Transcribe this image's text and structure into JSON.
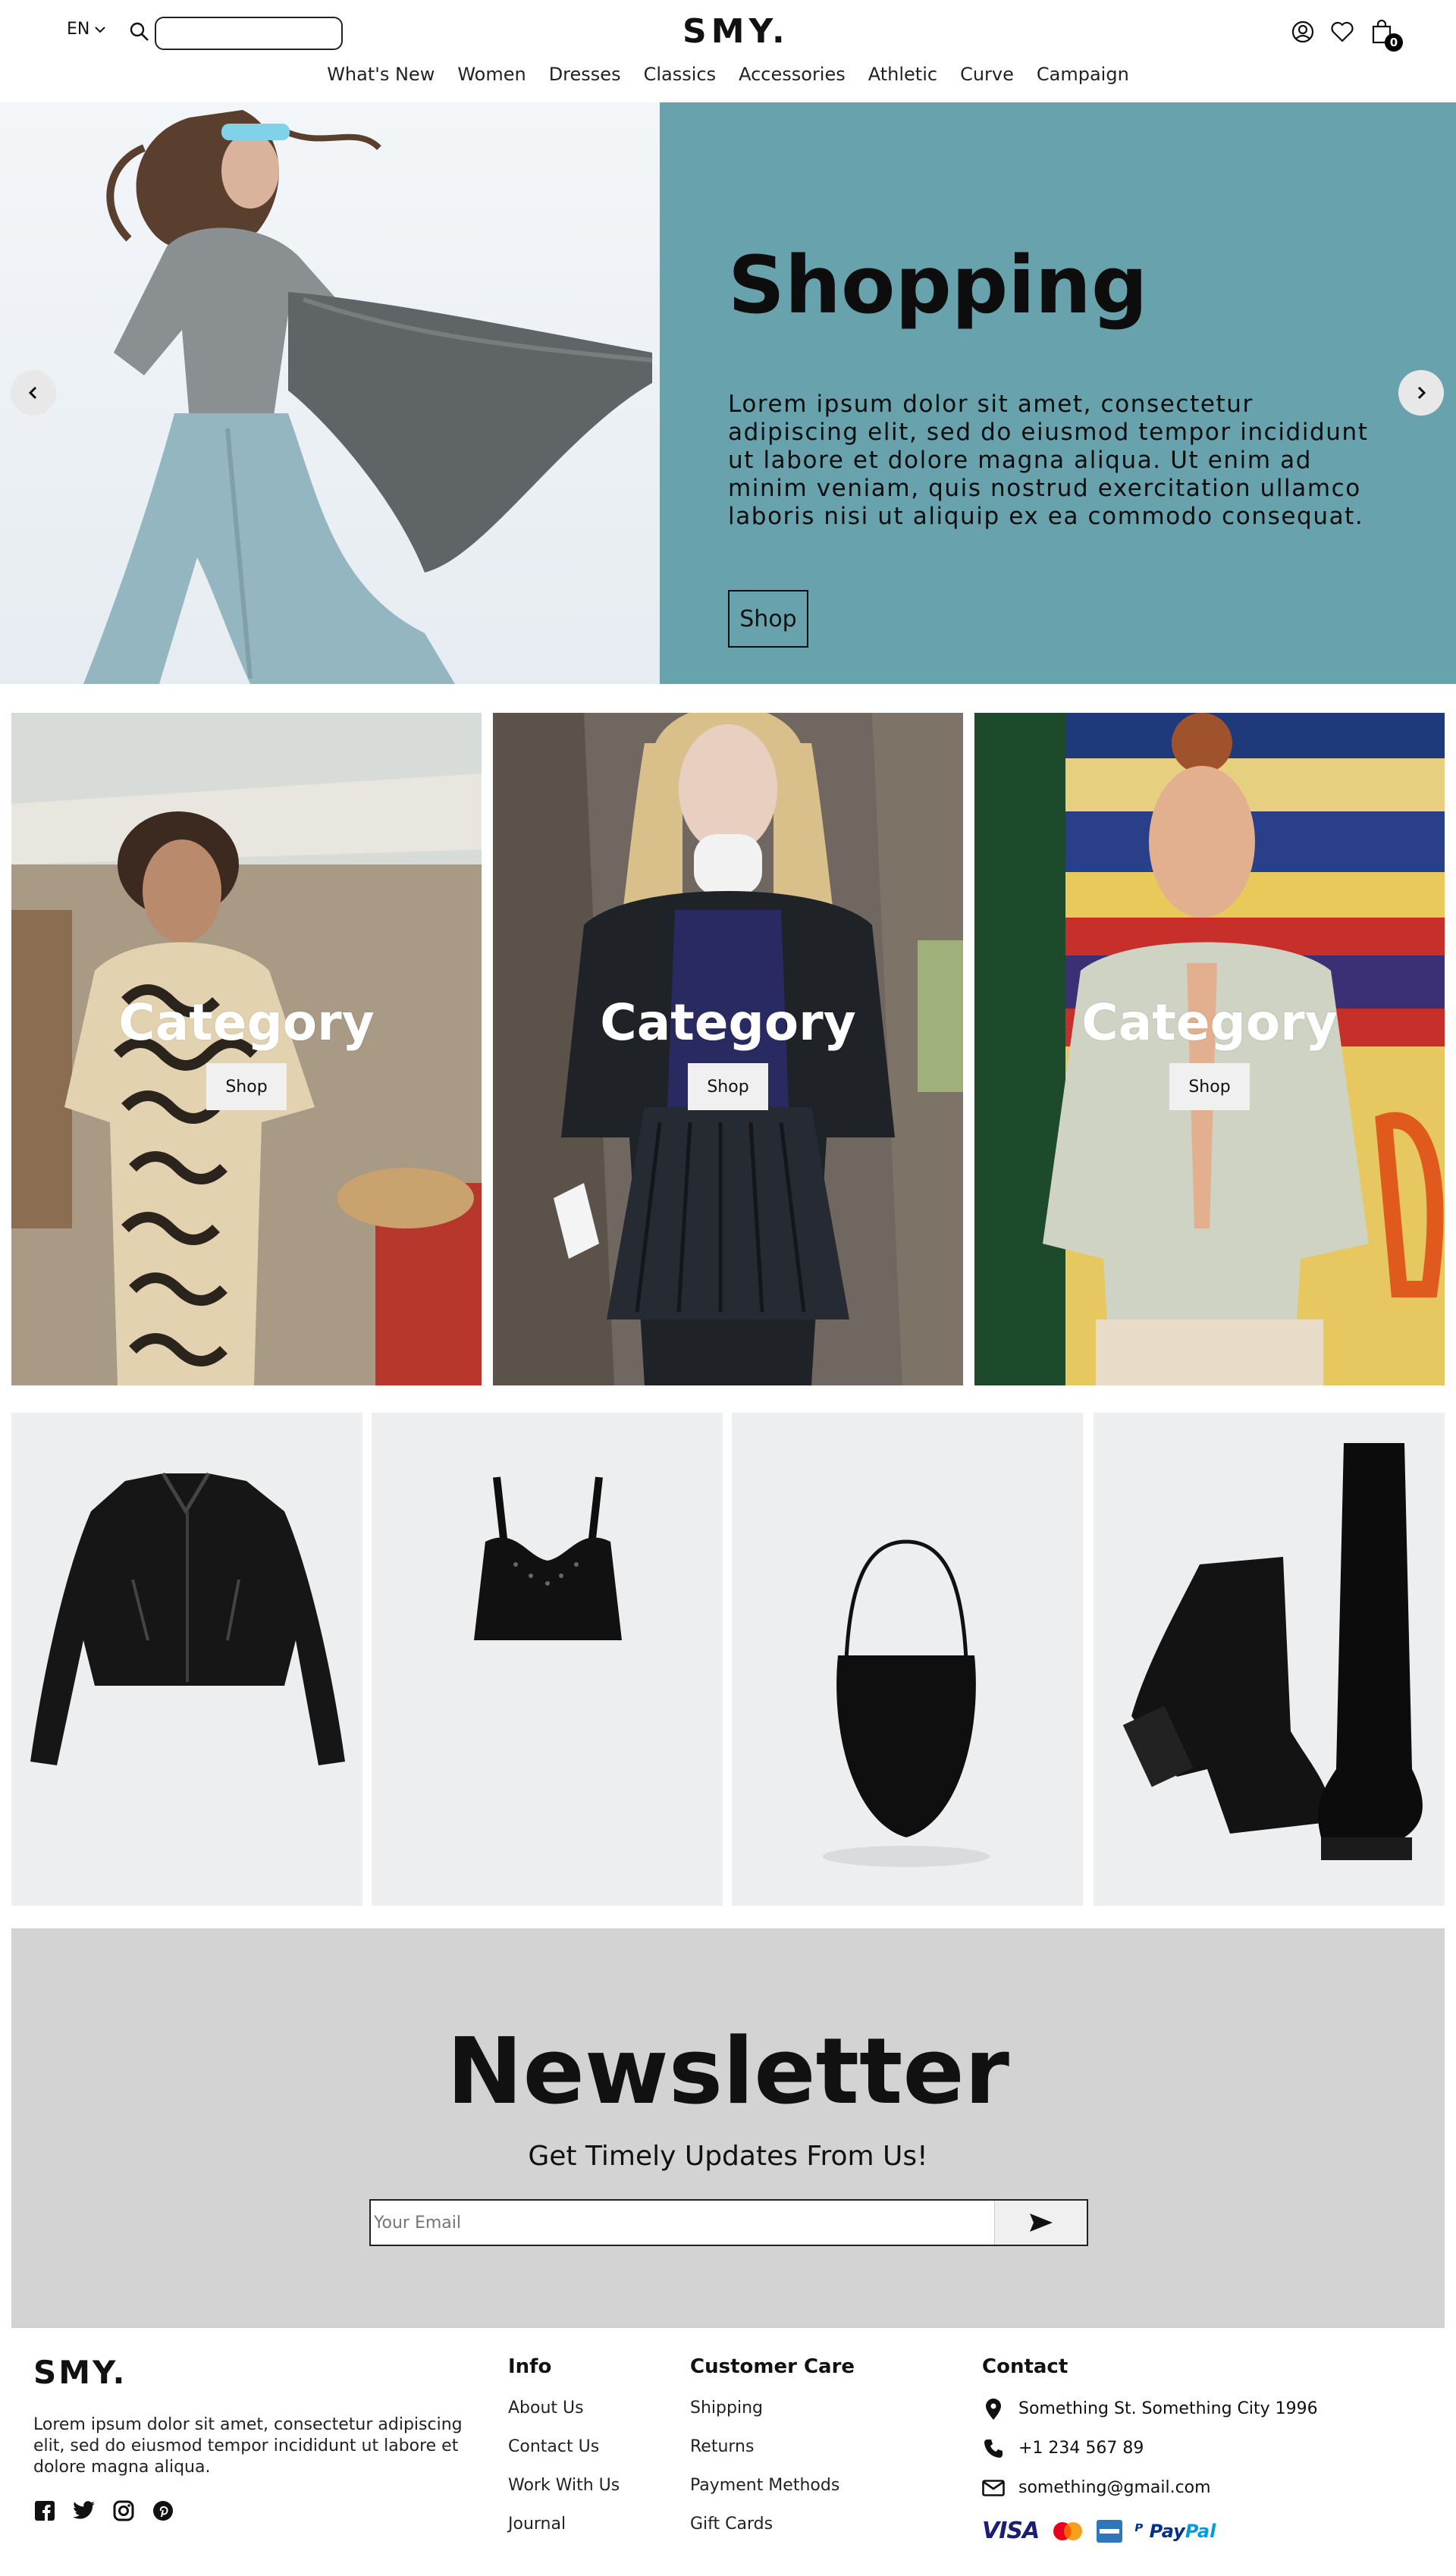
{
  "header": {
    "language": "EN",
    "search_placeholder": "",
    "logo": "SMY.",
    "cart_count": "0"
  },
  "nav": {
    "items": [
      "What's New",
      "Women",
      "Dresses",
      "Classics",
      "Accessories",
      "Athletic",
      "Curve",
      "Campaign"
    ]
  },
  "hero": {
    "title": "Shopping",
    "text": "Lorem ipsum dolor sit amet, consectetur adipiscing elit, sed do eiusmod tempor incididunt ut labore et dolore magna aliqua. Ut enim ad minim veniam, quis nostrud exercitation ullamco laboris nisi ut aliquip ex ea commodo consequat.",
    "button": "Shop",
    "panel_color": "#68a2ad"
  },
  "categories": [
    {
      "title": "Category",
      "button": "Shop"
    },
    {
      "title": "Category",
      "button": "Shop"
    },
    {
      "title": "Category",
      "button": "Shop"
    }
  ],
  "products": [
    {
      "icon": "leather-jacket"
    },
    {
      "icon": "crop-top"
    },
    {
      "icon": "handbag"
    },
    {
      "icon": "boots"
    }
  ],
  "newsletter": {
    "title": "Newsletter",
    "subtitle": "Get Timely Updates From Us!",
    "placeholder": "Your Email",
    "background": "#d3d3d3"
  },
  "footer": {
    "logo": "SMY.",
    "about": "Lorem ipsum dolor sit amet, consectetur adipiscing elit, sed do eiusmod tempor incididunt ut labore et dolore magna aliqua.",
    "info": {
      "heading": "Info",
      "links": [
        "About Us",
        "Contact Us",
        "Work With Us",
        "Journal"
      ]
    },
    "care": {
      "heading": "Customer Care",
      "links": [
        "Shipping",
        "Returns",
        "Payment Methods",
        "Gift Cards"
      ]
    },
    "contact": {
      "heading": "Contact",
      "address": "Something St. Something City 1996",
      "phone": "+1 234 567 89",
      "email": "something@gmail.com"
    },
    "payments": {
      "visa": "VISA",
      "paypal_pay": "Pay",
      "paypal_pal": "Pal"
    }
  }
}
